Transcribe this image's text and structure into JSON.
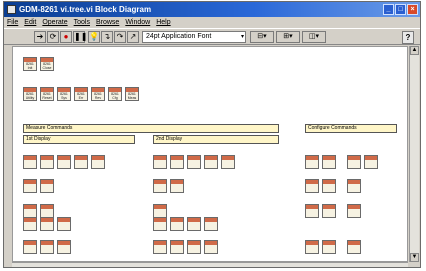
{
  "window": {
    "title": "GDM-8261 vi.tree.vi Block Diagram"
  },
  "menubar": {
    "items": [
      "File",
      "Edit",
      "Operate",
      "Tools",
      "Browse",
      "Window",
      "Help"
    ]
  },
  "toolbar": {
    "font_select": "24pt Application Font",
    "font_dropdown_glyph": "▾"
  },
  "sections": {
    "measure": "Measure Commands",
    "configure": "Configure Commands",
    "display1": "1st Display",
    "display2": "2nd Display"
  },
  "vi_rows": [
    {
      "t1": "8261",
      "t2": "Init"
    },
    {
      "t1": "8261",
      "t2": "Close"
    },
    {
      "t1": "8261",
      "t2": "Utility"
    },
    {
      "t1": "8261",
      "t2": "Reset"
    },
    {
      "t1": "8261",
      "t2": "Sys"
    },
    {
      "t1": "8261",
      "t2": "Err"
    },
    {
      "t1": "8261",
      "t2": "Rev"
    },
    {
      "t1": "8261",
      "t2": "Cfg"
    },
    {
      "t1": "8261",
      "t2": "Meas"
    }
  ],
  "colors": {
    "vi_header": "#d06a48",
    "section_fill": "#fff6c8",
    "titlebar": "#0a3d91"
  }
}
